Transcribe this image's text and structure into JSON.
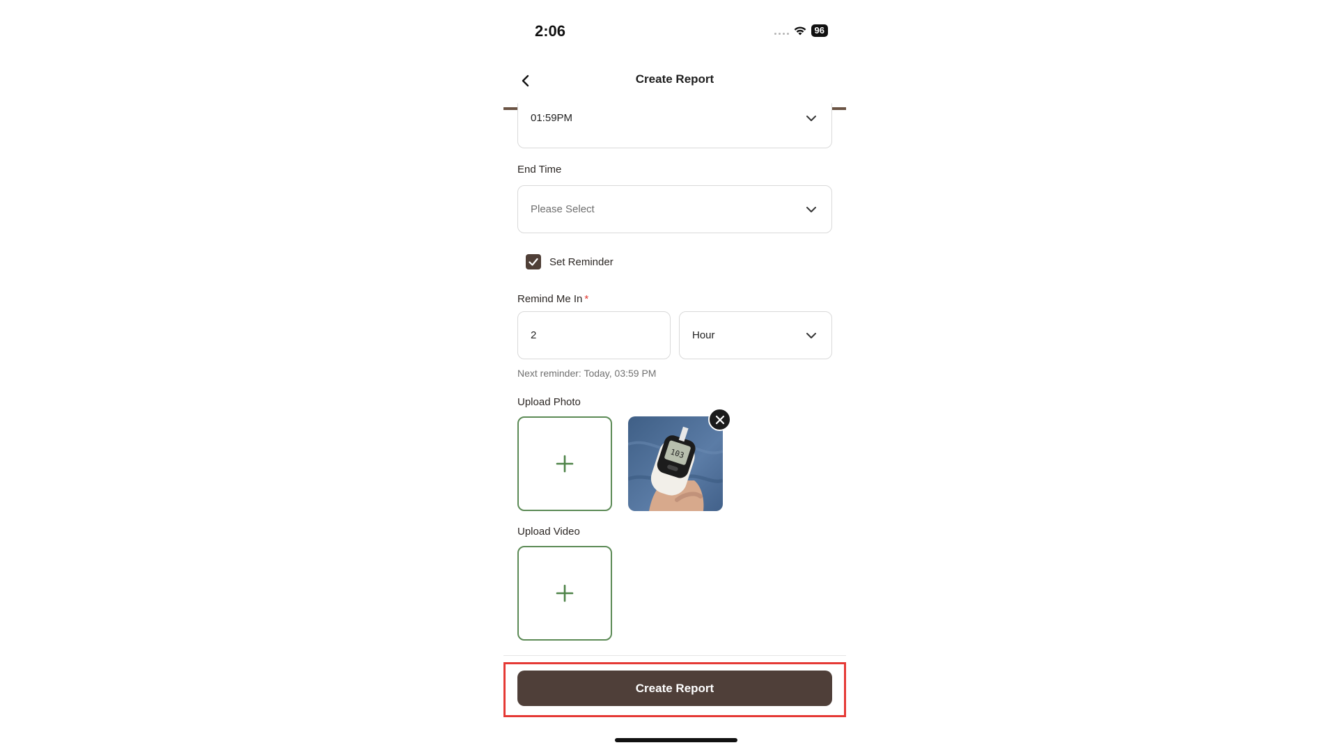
{
  "status_bar": {
    "time": "2:06",
    "battery": "96"
  },
  "header": {
    "title": "Create Report"
  },
  "start_time": {
    "value": "01:59PM"
  },
  "end_time": {
    "label": "End Time",
    "placeholder": "Please Select"
  },
  "reminder": {
    "checkbox_label": "Set Reminder",
    "checked": true,
    "remind_label": "Remind Me In",
    "required_mark": "*",
    "amount": "2",
    "unit": "Hour",
    "next_reminder": "Next reminder: Today, 03:59 PM"
  },
  "upload_photo": {
    "label": "Upload Photo"
  },
  "upload_video": {
    "label": "Upload Video"
  },
  "footer": {
    "primary_button": "Create Report"
  },
  "colors": {
    "brand_brown": "#4f3f39",
    "header_underline": "#6b5444",
    "upload_green": "#5b8a55",
    "highlight_red": "#e53935",
    "required_red": "#e0322a"
  }
}
